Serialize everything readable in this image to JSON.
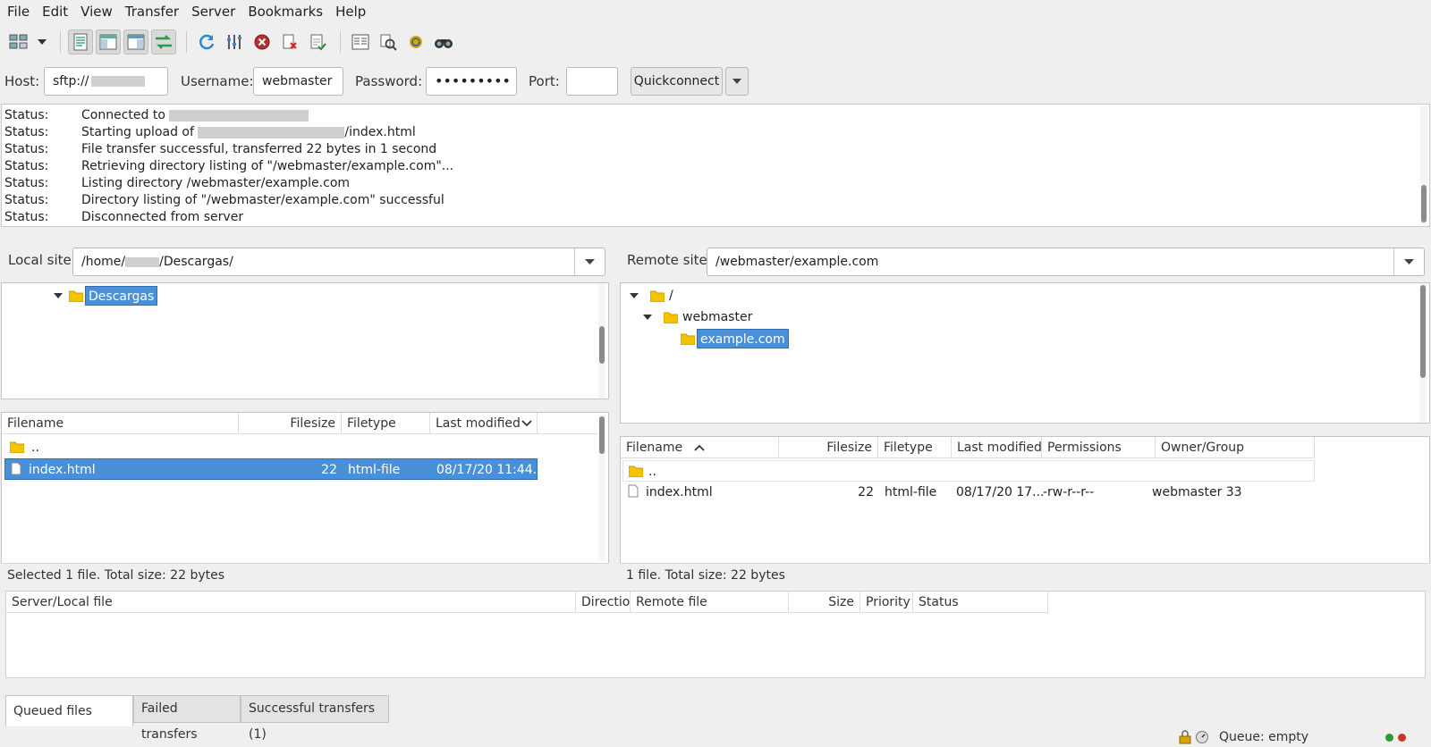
{
  "menu": [
    "File",
    "Edit",
    "View",
    "Transfer",
    "Server",
    "Bookmarks",
    "Help"
  ],
  "toolbar": {
    "icons": [
      "site-manager-icon",
      "dropdown-arrow-icon",
      "toggle-message-log-icon",
      "toggle-local-tree-icon",
      "toggle-remote-tree-icon",
      "toggle-transfer-queue-icon",
      "refresh-icon",
      "process-queue-icon",
      "cancel-icon",
      "disconnect-icon",
      "reconnect-icon",
      "directory-comparison-icon",
      "filter-icon",
      "synchronized-browsing-icon",
      "search-remote-icon"
    ]
  },
  "quickconnect": {
    "host_label": "Host:",
    "host_value": "sftp://",
    "username_label": "Username:",
    "username_value": "webmaster",
    "password_label": "Password:",
    "password_value": "•••••••••",
    "port_label": "Port:",
    "port_value": "",
    "button_label": "Quickconnect"
  },
  "log": [
    {
      "key": "Status:",
      "pre": "Connected to ",
      "post": ""
    },
    {
      "key": "Status:",
      "pre": "Starting upload of ",
      "post": "/index.html"
    },
    {
      "key": "Status:",
      "pre": "File transfer successful, transferred 22 bytes in 1 second",
      "post": ""
    },
    {
      "key": "Status:",
      "pre": "Retrieving directory listing of \"/webmaster/example.com\"...",
      "post": ""
    },
    {
      "key": "Status:",
      "pre": "Listing directory /webmaster/example.com",
      "post": ""
    },
    {
      "key": "Status:",
      "pre": "Directory listing of \"/webmaster/example.com\" successful",
      "post": ""
    },
    {
      "key": "Status:",
      "pre": "Disconnected from server",
      "post": ""
    }
  ],
  "local": {
    "site_label": "Local site:",
    "path_pre": "/home/",
    "path_post": "/Descargas/",
    "tree": [
      "Descargas"
    ],
    "columns": [
      "Filename",
      "Filesize",
      "Filetype",
      "Last modified"
    ],
    "rows": [
      {
        "name": "..",
        "size": "",
        "type": "",
        "modified": ""
      },
      {
        "name": "index.html",
        "size": "22",
        "type": "html-file",
        "modified": "08/17/20 11:44..."
      }
    ],
    "status": "Selected 1 file. Total size: 22 bytes"
  },
  "remote": {
    "site_label": "Remote site:",
    "path": "/webmaster/example.com",
    "tree": [
      "/",
      "webmaster",
      "example.com"
    ],
    "columns": [
      "Filename",
      "Filesize",
      "Filetype",
      "Last modified",
      "Permissions",
      "Owner/Group"
    ],
    "rows": [
      {
        "name": "..",
        "size": "",
        "type": "",
        "modified": "",
        "perms": "",
        "owner": ""
      },
      {
        "name": "index.html",
        "size": "22",
        "type": "html-file",
        "modified": "08/17/20 17...",
        "perms": "-rw-r--r--",
        "owner": "webmaster 33"
      }
    ],
    "status": "1 file. Total size: 22 bytes"
  },
  "queue": {
    "columns": [
      "Server/Local file",
      "Directio",
      "Remote file",
      "Size",
      "Priority",
      "Status"
    ],
    "tabs": [
      "Queued files",
      "Failed transfers",
      "Successful transfers (1)"
    ]
  },
  "statusbar": {
    "queue_text": "Queue: empty"
  },
  "colors": {
    "selection": "#4a90d9",
    "folder": "#f5c400",
    "led_green": "#2e9b2e",
    "led_red": "#c0392b"
  }
}
